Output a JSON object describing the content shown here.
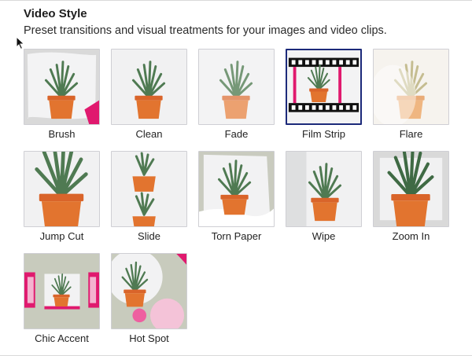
{
  "header": {
    "title": "Video Style",
    "subtitle": "Preset transitions and visual treatments for your images and video clips."
  },
  "styles": [
    {
      "label": "Brush",
      "selected": false
    },
    {
      "label": "Clean",
      "selected": false
    },
    {
      "label": "Fade",
      "selected": false
    },
    {
      "label": "Film Strip",
      "selected": true
    },
    {
      "label": "Flare",
      "selected": false
    },
    {
      "label": "Jump Cut",
      "selected": false
    },
    {
      "label": "Slide",
      "selected": false
    },
    {
      "label": "Torn Paper",
      "selected": false
    },
    {
      "label": "Wipe",
      "selected": false
    },
    {
      "label": "Zoom In",
      "selected": false
    },
    {
      "label": "Chic Accent",
      "selected": false
    },
    {
      "label": "Hot Spot",
      "selected": false
    }
  ],
  "colors": {
    "selected_border": "#1c2a7a",
    "accent_pink": "#e0196e",
    "pot_orange": "#e2742f",
    "leaf_green": "#4f7a52"
  }
}
